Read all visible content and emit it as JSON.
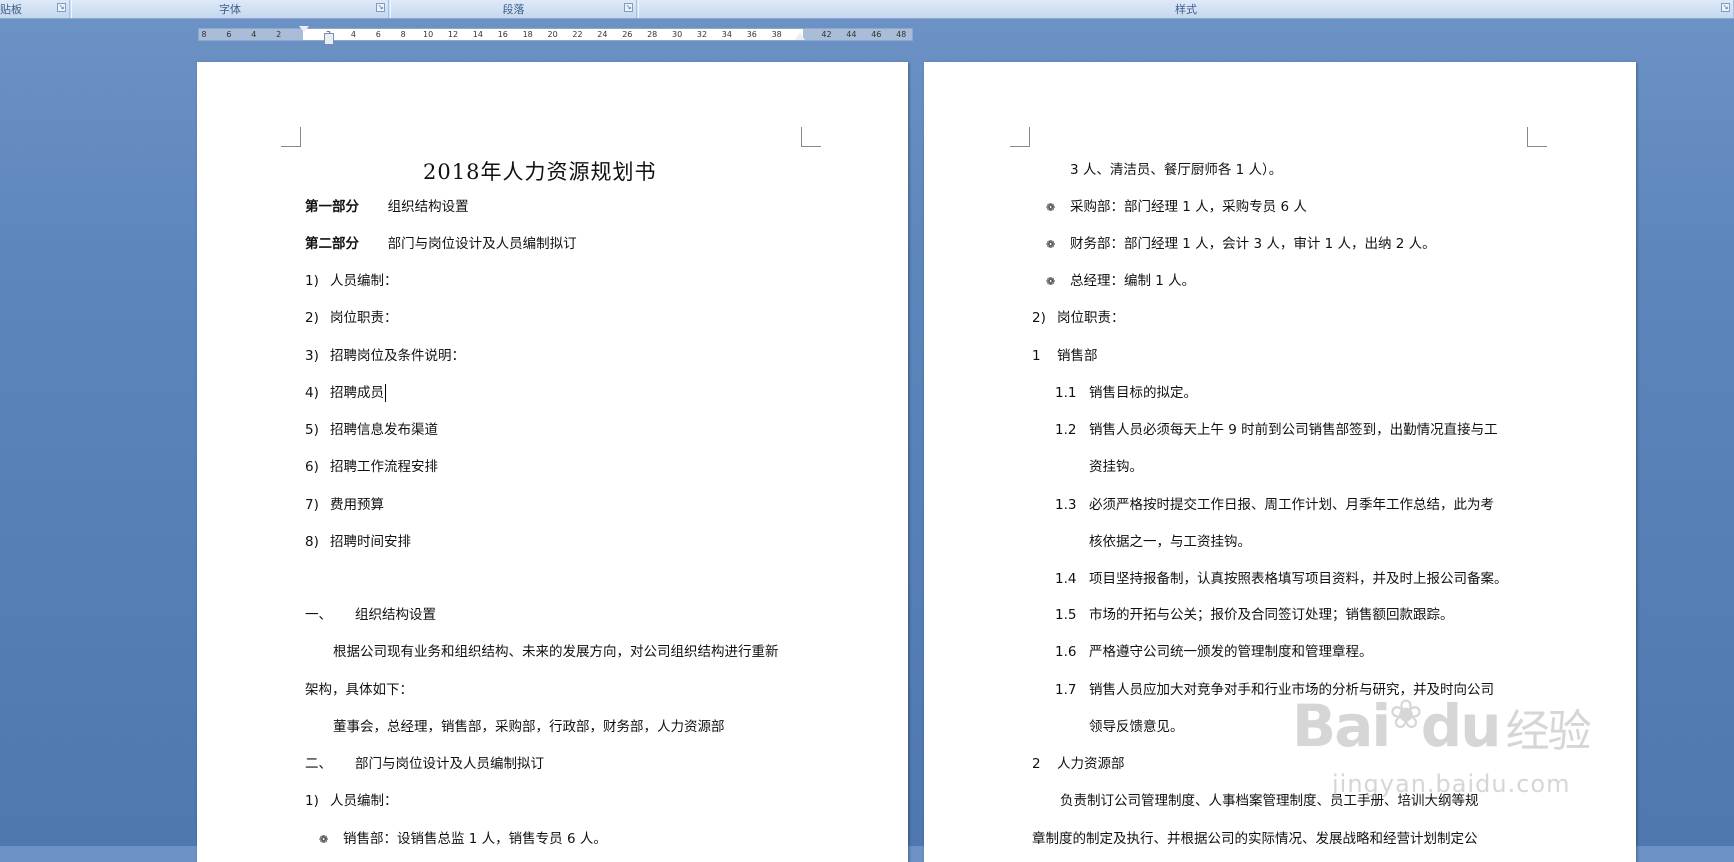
{
  "ribbon": {
    "groups": [
      {
        "label": "粘贴板"
      },
      {
        "label": "字体"
      },
      {
        "label": "段落"
      },
      {
        "label": "样式"
      }
    ]
  },
  "ruler": {
    "ticks": [
      "8",
      "6",
      "4",
      "2",
      "",
      "2",
      "4",
      "6",
      "8",
      "10",
      "12",
      "14",
      "16",
      "18",
      "20",
      "22",
      "24",
      "26",
      "28",
      "30",
      "32",
      "34",
      "36",
      "38",
      "",
      "42",
      "44",
      "46",
      "48"
    ]
  },
  "page1": {
    "title": "2018年人力资源规划书",
    "part1_label": "第一部分",
    "part1_text": "组织结构设置",
    "part2_label": "第二部分",
    "part2_text": "部门与岗位设计及人员编制拟订",
    "toc": [
      {
        "num": "1)",
        "text": "人员编制："
      },
      {
        "num": "2)",
        "text": "岗位职责："
      },
      {
        "num": "3)",
        "text": "招聘岗位及条件说明："
      },
      {
        "num": "4)",
        "text": "招聘成员"
      },
      {
        "num": "5)",
        "text": "招聘信息发布渠道"
      },
      {
        "num": "6)",
        "text": "招聘工作流程安排"
      },
      {
        "num": "7)",
        "text": "费用预算"
      },
      {
        "num": "8)",
        "text": "招聘时间安排"
      }
    ],
    "sec1_num": "一、",
    "sec1_text": "组织结构设置",
    "para1_a": "根据公司现有业务和组织结构、未来的发展方向，对公司组织结构进行重新",
    "para1_b": "架构，具体如下：",
    "para2": "董事会，总经理，销售部，采购部，行政部，财务部，人力资源部",
    "sec2_num": "二、",
    "sec2_text": "部门与岗位设计及人员编制拟订",
    "item1_num": "1)",
    "item1_text": "人员编制：",
    "bullet1": "销售部：设销售总监 1 人，销售专员 6 人。"
  },
  "page2": {
    "cont": "3 人、清洁员、餐厅厨师各 1 人）。",
    "bullets": [
      "采购部：部门经理 1 人，采购专员 6 人",
      "财务部：部门经理 1 人，会计 3 人，审计 1 人，出纳 2 人。",
      "总经理：编制 1 人。"
    ],
    "item2_num": "2)",
    "item2_text": "岗位职责：",
    "dept1_num": "1",
    "dept1_text": "销售部",
    "sub": [
      {
        "num": "1.1",
        "lines": [
          "销售目标的拟定。"
        ]
      },
      {
        "num": "1.2",
        "lines": [
          "销售人员必须每天上午 9 时前到公司销售部签到，出勤情况直接与工",
          "资挂钩。"
        ]
      },
      {
        "num": "1.3",
        "lines": [
          "必须严格按时提交工作日报、周工作计划、月季年工作总结，此为考",
          "核依据之一，与工资挂钩。"
        ]
      },
      {
        "num": "1.4",
        "lines": [
          "项目坚持报备制，认真按照表格填写项目资料，并及时上报公司备案。"
        ]
      },
      {
        "num": "1.5",
        "lines": [
          "市场的开拓与公关；报价及合同签订处理；销售额回款跟踪。"
        ]
      },
      {
        "num": "1.6",
        "lines": [
          "严格遵守公司统一颁发的管理制度和管理章程。"
        ]
      },
      {
        "num": "1.7",
        "lines": [
          "销售人员应加大对竞争对手和行业市场的分析与研究，并及时向公司",
          "领导反馈意见。"
        ]
      }
    ],
    "dept2_num": "2",
    "dept2_text": "人力资源部",
    "para_a": "负责制订公司管理制度、人事档案管理制度、员工手册、培训大纲等规",
    "para_b": "章制度的制定及执行、并根据公司的实际情况、发展战略和经营计划制定公"
  },
  "watermark": {
    "logo": "Bai",
    "logo2": "du",
    "cn": "经验",
    "url": "jingyan.baidu.com"
  }
}
